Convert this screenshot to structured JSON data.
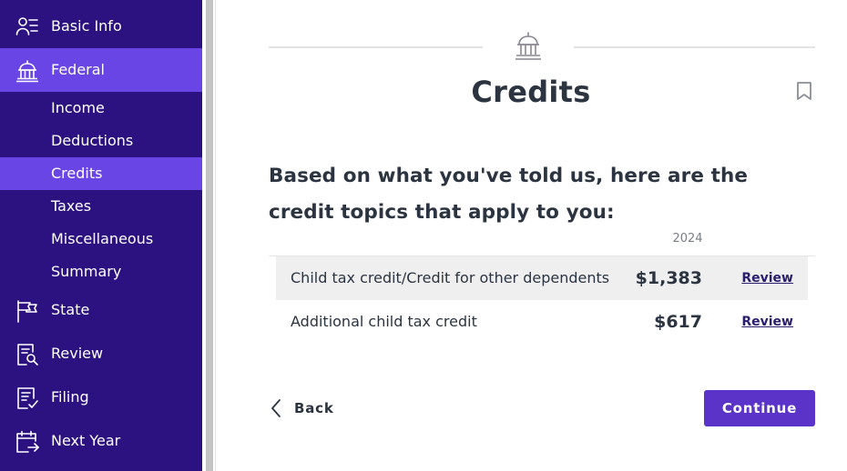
{
  "sidebar": {
    "items": [
      {
        "label": "Basic Info",
        "icon": "person-list-icon"
      },
      {
        "label": "Federal",
        "icon": "building-icon"
      },
      {
        "label": "State",
        "icon": "flag-icon"
      },
      {
        "label": "Review",
        "icon": "document-search-icon"
      },
      {
        "label": "Filing",
        "icon": "document-check-icon"
      },
      {
        "label": "Next Year",
        "icon": "calendar-arrow-icon"
      }
    ],
    "subitems": [
      {
        "label": "Income"
      },
      {
        "label": "Deductions"
      },
      {
        "label": "Credits"
      },
      {
        "label": "Taxes"
      },
      {
        "label": "Miscellaneous"
      },
      {
        "label": "Summary"
      }
    ],
    "active_item": "Federal",
    "active_subitem": "Credits"
  },
  "main": {
    "title": "Credits",
    "intro": "Based on what you've told us, here are the credit topics that apply to you:",
    "year_header": "2024",
    "credits": [
      {
        "name": "Child tax credit/Credit for other dependents",
        "amount": "$1,383",
        "action": "Review"
      },
      {
        "name": "Additional child tax credit",
        "amount": "$617",
        "action": "Review"
      }
    ],
    "back_label": "Back",
    "continue_label": "Continue"
  },
  "colors": {
    "sidebar_bg": "#2b1280",
    "sidebar_active": "#6a45e6",
    "primary_button": "#5b33c9",
    "text": "#2b3440"
  }
}
